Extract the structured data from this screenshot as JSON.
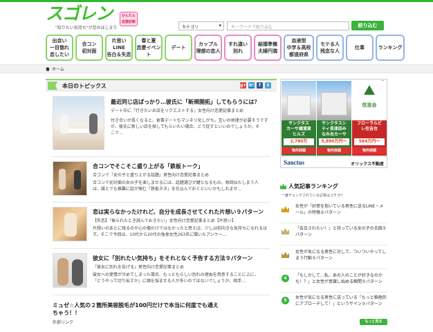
{
  "header": {
    "logo_text": "スゴレン",
    "tagline": "\"知りたい気持ち\"が恋のはじまり",
    "badge_text": "かんたん\n恋愛診断",
    "category_label": "カテゴリ",
    "keyword_placeholder": "キーワードで絞り込む",
    "search_button": "絞り込む"
  },
  "nav": [
    {
      "label": "出会い\n一目惚れ\n恋したい"
    },
    {
      "label": "合コン\n初対面"
    },
    {
      "label": "片思い\nLINE\n告白＆失恋"
    },
    {
      "label": "春と夏\n恋愛イベント"
    },
    {
      "label": "デート"
    },
    {
      "label": "カップル\n理想の恋人"
    },
    {
      "label": "すれ違い\n別れ"
    },
    {
      "label": "結婚準備\n夫婦円満"
    },
    {
      "label": "血液型\n中学＆高校\n都道府県"
    },
    {
      "label": "モテる人\n残念な人"
    },
    {
      "label": "仕事"
    },
    {
      "label": "ランキング"
    }
  ],
  "breadcrumb": {
    "home": "ホーム"
  },
  "topics": {
    "title": "本日のトピックス",
    "social": [
      "g+",
      "B!",
      "f",
      "t"
    ],
    "articles": [
      {
        "title": "最近同じ店ばっかり…彼氏に「新規開拓」してもらうには？",
        "lines": [
          "デート中に「行きたいお店をリクエストする」女性向け恋愛記事まとめ",
          "付き合いが長くなると、食事デートもマンネリ化しがち。互いの地理が必要そうです",
          "が、彼氏に新しい店を探してもらいたい場合、どう促すといいのでしょうか。そ",
          "こで…"
        ]
      },
      {
        "title": "合コンでそこそこ盛り上がる「鉄板トーク」",
        "lines": [
          "合コンで「女の子と盛り上がる話題」男性向け恋愛記事まとめ",
          "合コンで初対面の女の子を楽しませるには、話題選びが鍵となるもの。毎回似たしまう人",
          "は、誰とでも無難に話が弾む「鉄板ネタ」を仕込んでおくといいかもしれませ…"
        ]
      },
      {
        "title": "恋は実らなかったけれど、自分を成長させてくれた片想い９パターン",
        "lines": [
          "【失恋】「振られたとき読んでおきたい」女性向け恋愛記事まとめ【片思い】",
          "片想いのあとに残るのが心の傷だけではなかったと思えば、少しは前向きな気持ちになれるは",
          "ず。そこで今回は、10代から20代の独身女性263名に聞いたアンケー…"
        ]
      },
      {
        "title": "彼女に「別れたい気持ち」をそれとなく予告する方法９パターン",
        "lines": [
          "「彼女に別れを告げる」男性向け恋愛記事まとめ",
          "彼女への愛情が冷めてしまった場合、もっともらしい別れの理由を用意することに上に、",
          "「どうやって切り出すか」に頭を悩ませる人が多いのではないでしょうか。相手…"
        ]
      },
      {
        "title": "ミュゼ☆人気の２箇所美容脱毛が100円だけで本当に何度でも通え\nちゃう！！",
        "lines": [
          "外部リンク"
        ]
      }
    ]
  },
  "ad": {
    "columns": [
      {
        "name": "サンクタス\nカーサ横濱寅\nヒルズ",
        "price": "2,780万",
        "button": "物件詳細"
      },
      {
        "name": "サンクタスシ\nティ長津田み\nなみ台カーサ",
        "price": "5,890万円〜",
        "button": "物件詳細"
      },
      {
        "name": "フローラルビ\nレ住吉台",
        "price": "584万円〜",
        "button": "物件詳細",
        "top_label": "住吉台"
      }
    ],
    "brand_left": "Sanctus",
    "brand_right": "オリックス不動産",
    "info": "i"
  },
  "ranking": {
    "title": "人気記事ランキング",
    "subtitle": "一番チェックされている記事はコチラ!!",
    "items": [
      {
        "rank": "1",
        "text": "女性が「好意を抱いている男性に送るLINE・メール」の特徴８パターン"
      },
      {
        "rank": "2",
        "text": "「告白されたい！」と持っている女の子の合図９パターン"
      },
      {
        "rank": "3",
        "text": "女性が気になる男性に対して、ついついやってしまう行動９パターン"
      },
      {
        "rank": "4",
        "text": "「もしかして…私、あの人のことが好きなのかも！？」と女性が意識し始める瞬間９パターン"
      },
      {
        "rank": "5",
        "text": "女性が気になる男性に送っている「もっと積極的にアプローチして！」というサイン９パターン"
      }
    ],
    "more_button": "もっと見る"
  },
  "colors": {
    "brand_green": "#3cb33c",
    "nav_border": "#8bd46b"
  }
}
